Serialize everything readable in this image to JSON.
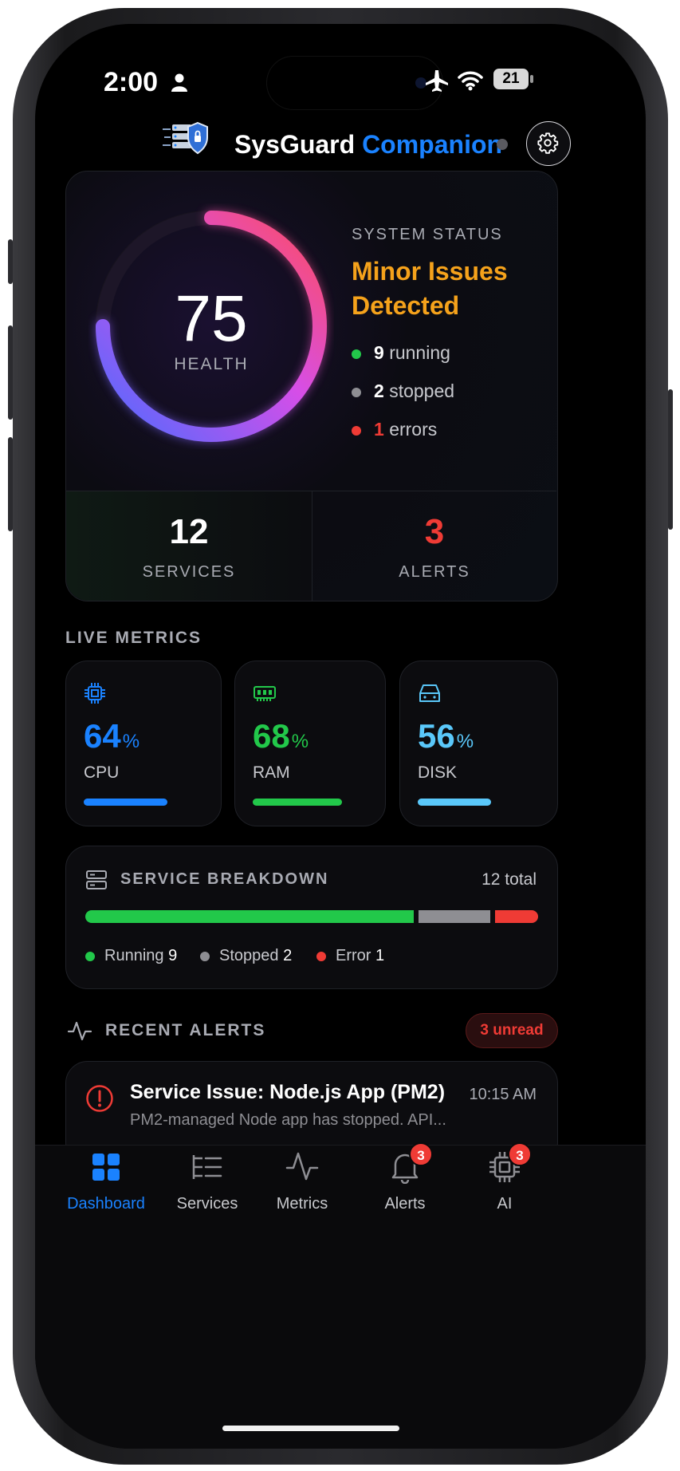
{
  "status_bar": {
    "time": "2:00",
    "battery": "21"
  },
  "header": {
    "brand_part1": "SysGuard",
    "brand_part2": "Companion"
  },
  "health": {
    "score": "75",
    "score_label": "HEALTH",
    "status_label": "SYSTEM STATUS",
    "status_line1": "Minor Issues",
    "status_line2": "Detected",
    "running_count": "9",
    "running_label": "running",
    "stopped_count": "2",
    "stopped_label": "stopped",
    "errors_count": "1",
    "errors_label": "errors",
    "services_count": "12",
    "services_label": "SERVICES",
    "alerts_count": "3",
    "alerts_label": "ALERTS"
  },
  "live_metrics": {
    "title": "LIVE METRICS",
    "cpu": {
      "value": "64",
      "unit": "%",
      "label": "CPU",
      "level": 0.64,
      "icon": "cpu-icon"
    },
    "ram": {
      "value": "68",
      "unit": "%",
      "label": "RAM",
      "level": 0.68,
      "icon": "memory-icon"
    },
    "disk": {
      "value": "56",
      "unit": "%",
      "label": "DISK",
      "level": 0.56,
      "icon": "disk-icon"
    }
  },
  "breakdown": {
    "title": "SERVICE BREAKDOWN",
    "total": "12 total",
    "running_label": "Running",
    "running_value": "9",
    "stopped_label": "Stopped",
    "stopped_value": "2",
    "error_label": "Error",
    "error_value": "1"
  },
  "recent_alerts": {
    "title": "RECENT ALERTS",
    "unread": "3 unread",
    "items": [
      {
        "title": "Service Issue: Node.js App (PM2)",
        "time": "10:15 AM",
        "body": "PM2-managed Node app has stopped. API..."
      }
    ]
  },
  "tabs": [
    {
      "label": "Dashboard",
      "active": true
    },
    {
      "label": "Services"
    },
    {
      "label": "Metrics"
    },
    {
      "label": "Alerts",
      "badge": "3"
    },
    {
      "label": "AI",
      "badge": "3"
    }
  ],
  "colors": {
    "accent": "#1a82ff",
    "warning": "#f5a21b",
    "success": "#22c84a",
    "danger": "#ef3b35",
    "muted": "#8e8e93",
    "disk": "#5ac8fa"
  }
}
